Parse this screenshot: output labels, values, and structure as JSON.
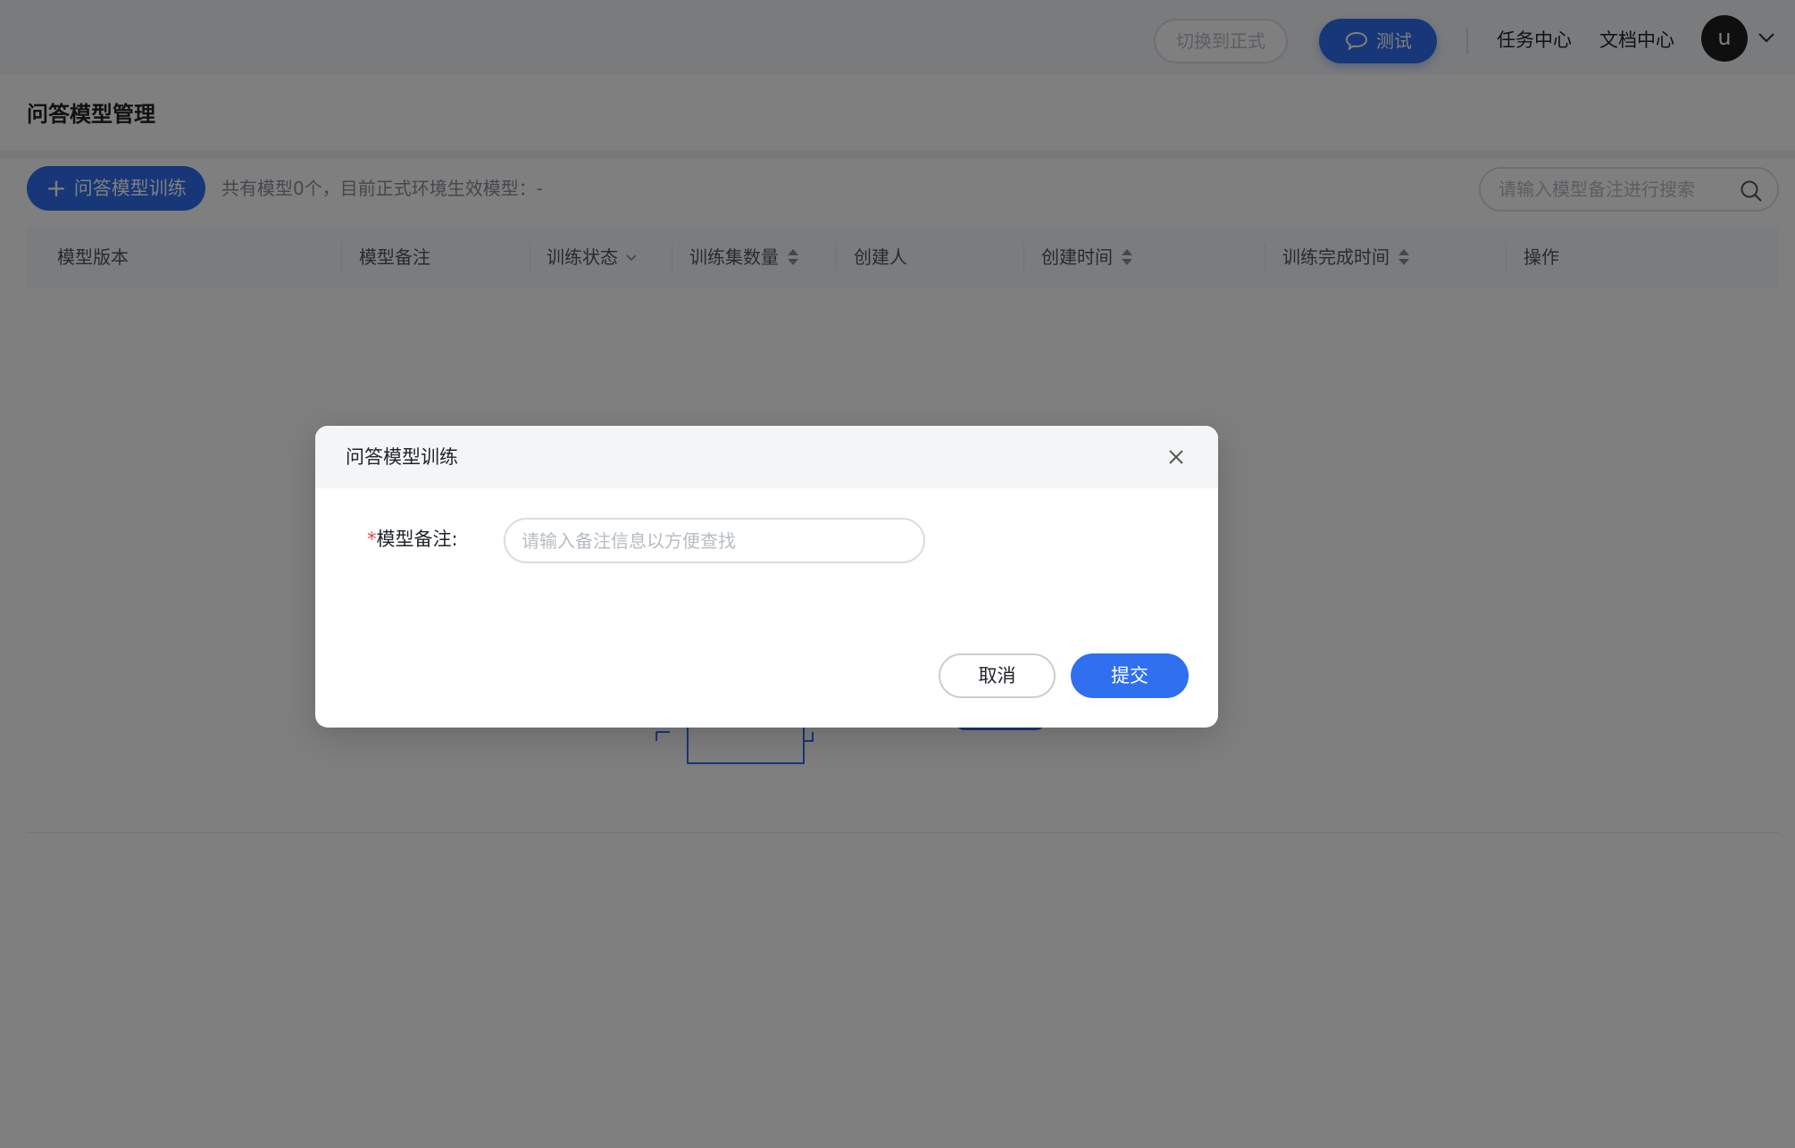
{
  "topbar": {
    "switch_label": "切换到正式",
    "test_label": "测试",
    "task_center": "任务中心",
    "doc_center": "文档中心",
    "avatar_letter": "u",
    "icons": {
      "test": "chat-bubble-icon",
      "user_menu": "chevron-down-icon"
    }
  },
  "page": {
    "title": "问答模型管理",
    "train_button": "问答模型训练",
    "summary": "共有模型0个，目前正式环境生效模型：-",
    "search_placeholder": "请输入模型备注进行搜索"
  },
  "table": {
    "columns": [
      "模型版本",
      "模型备注",
      "训练状态",
      "训练集数量",
      "创建人",
      "创建时间",
      "训练完成时间",
      "操作"
    ]
  },
  "modal": {
    "title": "问答模型训练",
    "field_label": "模型备注:",
    "field_required_mark": "*",
    "field_placeholder": "请输入备注信息以方便查找",
    "field_value": "",
    "cancel_label": "取消",
    "submit_label": "提交"
  },
  "colors": {
    "accent": "#2f6ff0",
    "required": "#e5484d",
    "overlay": "rgba(0,0,0,0.5)"
  }
}
